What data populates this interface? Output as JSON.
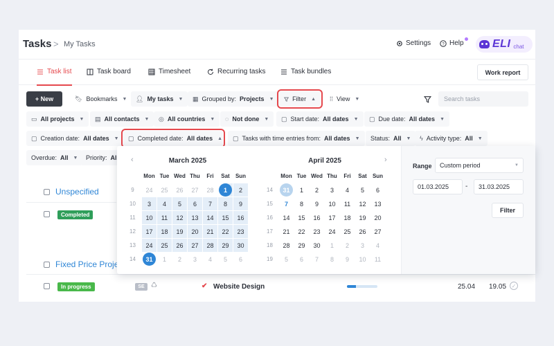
{
  "header": {
    "title": "Tasks",
    "separator": ">",
    "breadcrumb": "My Tasks",
    "settings": "Settings",
    "help": "Help",
    "eli_logo": "ELI",
    "eli_chat": "chat"
  },
  "tabs": [
    {
      "label": "Task list",
      "icon": "list-icon",
      "active": true
    },
    {
      "label": "Task board",
      "icon": "board-icon",
      "active": false
    },
    {
      "label": "Timesheet",
      "icon": "grid-icon",
      "active": false
    },
    {
      "label": "Recurring tasks",
      "icon": "refresh-icon",
      "active": false
    },
    {
      "label": "Task bundles",
      "icon": "stack-icon",
      "active": false
    }
  ],
  "work_report": "Work report",
  "toolbar": {
    "new": "+ New",
    "bookmarks": "Bookmarks",
    "my_tasks": "My tasks",
    "grouped_by_label": "Grouped by:",
    "grouped_by_value": "Projects",
    "filter": "Filter",
    "view": "View",
    "search_placeholder": "Search tasks"
  },
  "filters": {
    "all_projects": "All projects",
    "all_contacts": "All contacts",
    "all_countries": "All countries",
    "not_done": "Not done",
    "start_date_label": "Start date:",
    "start_date_value": "All dates",
    "due_date_label": "Due date:",
    "due_date_value": "All dates",
    "creation_date_label": "Creation date:",
    "creation_date_value": "All dates",
    "completed_date_label": "Completed date:",
    "completed_date_value": "All dates",
    "time_entries_label": "Tasks with time entries from:",
    "time_entries_value": "All dates",
    "status_label": "Status:",
    "status_value": "All",
    "activity_label": "Activity type:",
    "activity_value": "All",
    "overdue_label": "Overdue:",
    "overdue_value": "All",
    "priority_label": "Priority:",
    "priority_value": "All"
  },
  "groups": [
    {
      "title": "Unspecified",
      "badge": "Completed"
    },
    {
      "title": "Fixed Price Proje",
      "badge": "In progress",
      "initials": "SE",
      "task": "Website Design",
      "start": "25.04",
      "end": "19.05",
      "progress": 0.3
    }
  ],
  "calendar": {
    "weekdays": [
      "Mon",
      "Tue",
      "Wed",
      "Thu",
      "Fri",
      "Sat",
      "Sun"
    ],
    "nav_prev": "‹",
    "nav_next": "›",
    "march": {
      "title": "March 2025",
      "weeks": [
        {
          "wk": "9",
          "days": [
            "24",
            "25",
            "26",
            "27",
            "28",
            "1",
            "2"
          ]
        },
        {
          "wk": "10",
          "days": [
            "3",
            "4",
            "5",
            "6",
            "7",
            "8",
            "9"
          ]
        },
        {
          "wk": "11",
          "days": [
            "10",
            "11",
            "12",
            "13",
            "14",
            "15",
            "16"
          ]
        },
        {
          "wk": "12",
          "days": [
            "17",
            "18",
            "19",
            "20",
            "21",
            "22",
            "23"
          ]
        },
        {
          "wk": "13",
          "days": [
            "24",
            "25",
            "26",
            "27",
            "28",
            "29",
            "30"
          ]
        },
        {
          "wk": "14",
          "days": [
            "31",
            "1",
            "2",
            "3",
            "4",
            "5",
            "6"
          ]
        }
      ]
    },
    "april": {
      "title": "April 2025",
      "weeks": [
        {
          "wk": "14",
          "days": [
            "31",
            "1",
            "2",
            "3",
            "4",
            "5",
            "6"
          ]
        },
        {
          "wk": "15",
          "days": [
            "7",
            "8",
            "9",
            "10",
            "11",
            "12",
            "13"
          ]
        },
        {
          "wk": "16",
          "days": [
            "14",
            "15",
            "16",
            "17",
            "18",
            "19",
            "20"
          ]
        },
        {
          "wk": "17",
          "days": [
            "21",
            "22",
            "23",
            "24",
            "25",
            "26",
            "27"
          ]
        },
        {
          "wk": "18",
          "days": [
            "28",
            "29",
            "30",
            "1",
            "2",
            "3",
            "4"
          ]
        },
        {
          "wk": "19",
          "days": [
            "5",
            "6",
            "7",
            "8",
            "9",
            "10",
            "11"
          ]
        }
      ]
    },
    "range_label": "Range",
    "range_value": "Custom period",
    "from": "01.03.2025",
    "to": "31.03.2025",
    "dash": "-",
    "apply": "Filter"
  },
  "colors": {
    "accent_red": "#e5484d",
    "selected_blue": "#2f86d6",
    "range_bg": "#e4eef8",
    "completed_green": "#2f9e5a",
    "in_progress_green": "#49b84a"
  }
}
